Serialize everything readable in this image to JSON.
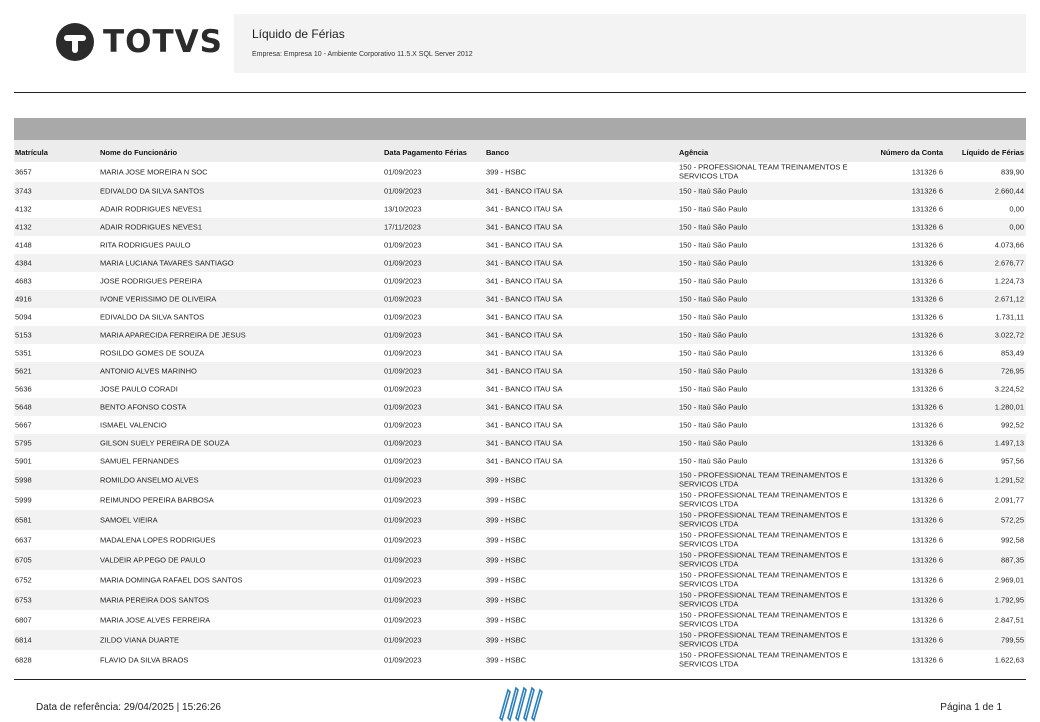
{
  "brand": {
    "name": "TOTVS",
    "icon": "totvs-logo-icon"
  },
  "report": {
    "title": "Líquido de Férias",
    "subtitle": "Empresa: Empresa 10 - Ambiente Corporativo 11.5.X SQL Server 2012"
  },
  "table": {
    "columns": {
      "matricula": "Matrícula",
      "nome": "Nome do Funcionário",
      "data": "Data Pagamento Férias",
      "banco": "Banco",
      "agencia": "Agência",
      "conta": "Número da Conta",
      "liquido": "Líquido de Férias"
    },
    "rows": [
      {
        "matricula": "3657",
        "nome": "MARIA JOSE MOREIRA N SOC",
        "data": "01/09/2023",
        "banco": "399 - HSBC",
        "agencia": "150 - PROFESSIONAL TEAM TREINAMENTOS E SERVICOS LTDA",
        "conta": "131326 6",
        "liquido": "839,90"
      },
      {
        "matricula": "3743",
        "nome": "EDIVALDO DA SILVA SANTOS",
        "data": "01/09/2023",
        "banco": "341 - BANCO ITAU SA",
        "agencia": "150 - Itaú São Paulo",
        "conta": "131326 6",
        "liquido": "2.660,44"
      },
      {
        "matricula": "4132",
        "nome": "ADAIR RODRIGUES NEVES1",
        "data": "13/10/2023",
        "banco": "341 - BANCO ITAU SA",
        "agencia": "150 - Itaú São Paulo",
        "conta": "131326 6",
        "liquido": "0,00"
      },
      {
        "matricula": "4132",
        "nome": "ADAIR RODRIGUES NEVES1",
        "data": "17/11/2023",
        "banco": "341 - BANCO ITAU SA",
        "agencia": "150 - Itaú São Paulo",
        "conta": "131326 6",
        "liquido": "0,00"
      },
      {
        "matricula": "4148",
        "nome": "RITA RODRIGUES PAULO",
        "data": "01/09/2023",
        "banco": "341 - BANCO ITAU SA",
        "agencia": "150 - Itaú São Paulo",
        "conta": "131326 6",
        "liquido": "4.073,66"
      },
      {
        "matricula": "4384",
        "nome": "MARIA LUCIANA TAVARES SANTIAGO",
        "data": "01/09/2023",
        "banco": "341 - BANCO ITAU SA",
        "agencia": "150 - Itaú São Paulo",
        "conta": "131326 6",
        "liquido": "2.676,77"
      },
      {
        "matricula": "4683",
        "nome": "JOSE RODRIGUES PEREIRA",
        "data": "01/09/2023",
        "banco": "341 - BANCO ITAU SA",
        "agencia": "150 - Itaú São Paulo",
        "conta": "131326 6",
        "liquido": "1.224,73"
      },
      {
        "matricula": "4916",
        "nome": "IVONE VERISSIMO DE OLIVEIRA",
        "data": "01/09/2023",
        "banco": "341 - BANCO ITAU SA",
        "agencia": "150 - Itaú São Paulo",
        "conta": "131326 6",
        "liquido": "2.671,12"
      },
      {
        "matricula": "5094",
        "nome": "EDIVALDO DA SILVA SANTOS",
        "data": "01/09/2023",
        "banco": "341 - BANCO ITAU SA",
        "agencia": "150 - Itaú São Paulo",
        "conta": "131326 6",
        "liquido": "1.731,11"
      },
      {
        "matricula": "5153",
        "nome": "MARIA APARECIDA FERREIRA DE JESUS",
        "data": "01/09/2023",
        "banco": "341 - BANCO ITAU SA",
        "agencia": "150 - Itaú São Paulo",
        "conta": "131326 6",
        "liquido": "3.022,72"
      },
      {
        "matricula": "5351",
        "nome": "ROSILDO GOMES DE SOUZA",
        "data": "01/09/2023",
        "banco": "341 - BANCO ITAU SA",
        "agencia": "150 - Itaú São Paulo",
        "conta": "131326 6",
        "liquido": "853,49"
      },
      {
        "matricula": "5621",
        "nome": "ANTONIO ALVES MARINHO",
        "data": "01/09/2023",
        "banco": "341 - BANCO ITAU SA",
        "agencia": "150 - Itaú São Paulo",
        "conta": "131326 6",
        "liquido": "726,95"
      },
      {
        "matricula": "5636",
        "nome": "JOSE PAULO CORADI",
        "data": "01/09/2023",
        "banco": "341 - BANCO ITAU SA",
        "agencia": "150 - Itaú São Paulo",
        "conta": "131326 6",
        "liquido": "3.224,52"
      },
      {
        "matricula": "5648",
        "nome": "BENTO AFONSO COSTA",
        "data": "01/09/2023",
        "banco": "341 - BANCO ITAU SA",
        "agencia": "150 - Itaú São Paulo",
        "conta": "131326 6",
        "liquido": "1.280,01"
      },
      {
        "matricula": "5667",
        "nome": "ISMAEL VALENCIO",
        "data": "01/09/2023",
        "banco": "341 - BANCO ITAU SA",
        "agencia": "150 - Itaú São Paulo",
        "conta": "131326 6",
        "liquido": "992,52"
      },
      {
        "matricula": "5795",
        "nome": "GILSON SUELY PEREIRA DE SOUZA",
        "data": "01/09/2023",
        "banco": "341 - BANCO ITAU SA",
        "agencia": "150 - Itaú São Paulo",
        "conta": "131326 6",
        "liquido": "1.497,13"
      },
      {
        "matricula": "5901",
        "nome": "SAMUEL FERNANDES",
        "data": "01/09/2023",
        "banco": "341 - BANCO ITAU SA",
        "agencia": "150 - Itaú São Paulo",
        "conta": "131326 6",
        "liquido": "957,56"
      },
      {
        "matricula": "5998",
        "nome": "ROMILDO ANSELMO ALVES",
        "data": "01/09/2023",
        "banco": "399 - HSBC",
        "agencia": "150 - PROFESSIONAL TEAM TREINAMENTOS E SERVICOS LTDA",
        "conta": "131326 6",
        "liquido": "1.291,52"
      },
      {
        "matricula": "5999",
        "nome": "REIMUNDO PEREIRA BARBOSA",
        "data": "01/09/2023",
        "banco": "399 - HSBC",
        "agencia": "150 - PROFESSIONAL TEAM TREINAMENTOS E SERVICOS LTDA",
        "conta": "131326 6",
        "liquido": "2.091,77"
      },
      {
        "matricula": "6581",
        "nome": "SAMOEL VIEIRA",
        "data": "01/09/2023",
        "banco": "399 - HSBC",
        "agencia": "150 - PROFESSIONAL TEAM TREINAMENTOS E SERVICOS LTDA",
        "conta": "131326 6",
        "liquido": "572,25"
      },
      {
        "matricula": "6637",
        "nome": "MADALENA LOPES RODRIGUES",
        "data": "01/09/2023",
        "banco": "399 - HSBC",
        "agencia": "150 - PROFESSIONAL TEAM TREINAMENTOS E SERVICOS LTDA",
        "conta": "131326 6",
        "liquido": "992,58"
      },
      {
        "matricula": "6705",
        "nome": "VALDEIR AP.PEGO DE PAULO",
        "data": "01/09/2023",
        "banco": "399 - HSBC",
        "agencia": "150 - PROFESSIONAL TEAM TREINAMENTOS E SERVICOS LTDA",
        "conta": "131326 6",
        "liquido": "887,35"
      },
      {
        "matricula": "6752",
        "nome": "MARIA DOMINGA RAFAEL DOS SANTOS",
        "data": "01/09/2023",
        "banco": "399 - HSBC",
        "agencia": "150 - PROFESSIONAL TEAM TREINAMENTOS E SERVICOS LTDA",
        "conta": "131326 6",
        "liquido": "2.969,01"
      },
      {
        "matricula": "6753",
        "nome": "MARIA PEREIRA DOS SANTOS",
        "data": "01/09/2023",
        "banco": "399 - HSBC",
        "agencia": "150 - PROFESSIONAL TEAM TREINAMENTOS E SERVICOS LTDA",
        "conta": "131326 6",
        "liquido": "1.792,95"
      },
      {
        "matricula": "6807",
        "nome": "MARIA JOSE ALVES FERREIRA",
        "data": "01/09/2023",
        "banco": "399 - HSBC",
        "agencia": "150 - PROFESSIONAL TEAM TREINAMENTOS E SERVICOS LTDA",
        "conta": "131326 6",
        "liquido": "2.847,51"
      },
      {
        "matricula": "6814",
        "nome": "ZILDO VIANA DUARTE",
        "data": "01/09/2023",
        "banco": "399 - HSBC",
        "agencia": "150 - PROFESSIONAL TEAM TREINAMENTOS E SERVICOS LTDA",
        "conta": "131326 6",
        "liquido": "799,55"
      },
      {
        "matricula": "6828",
        "nome": "FLAVIO DA SILVA BRAOS",
        "data": "01/09/2023",
        "banco": "399 - HSBC",
        "agencia": "150 - PROFESSIONAL TEAM TREINAMENTOS E SERVICOS LTDA",
        "conta": "131326 6",
        "liquido": "1.622,63"
      }
    ]
  },
  "footer": {
    "ref_text": "Data de referência:  29/04/2025 | 15:26:26",
    "page_text": "Página  1  de  1",
    "mark_icon": "fluig-stripes-icon",
    "mark_color": "#2a7fc0"
  }
}
